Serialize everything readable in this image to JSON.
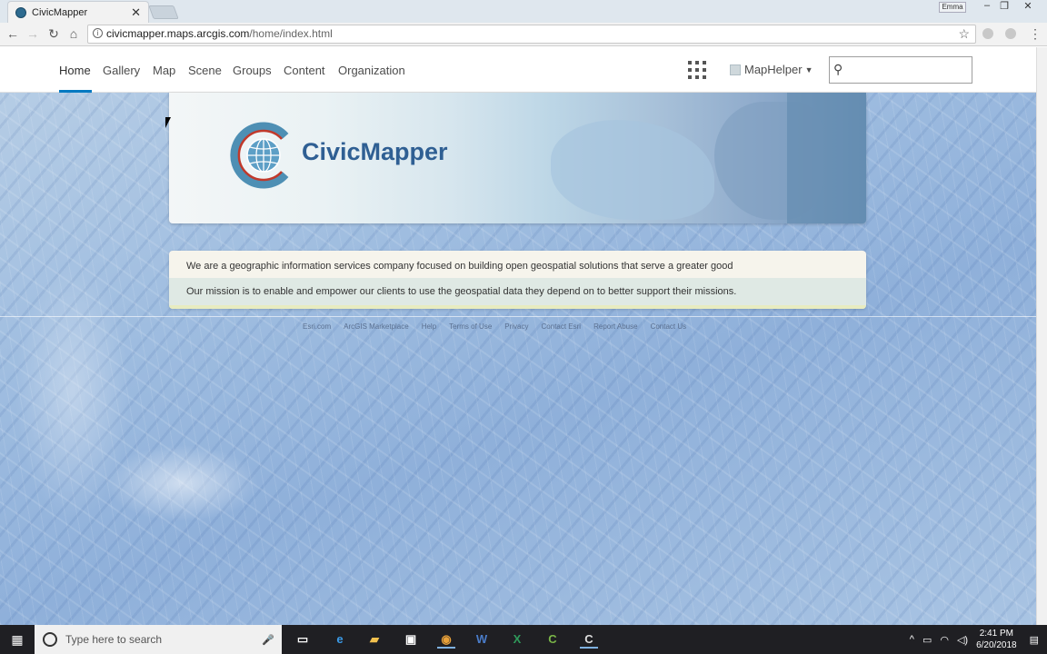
{
  "browser": {
    "tab_title": "CivicMapper",
    "tab_close": "✕",
    "user_chip": "Emma",
    "url_host": "civicmapper.maps.arcgis.com",
    "url_path": "/home/index.html"
  },
  "nav": {
    "links": [
      "Home",
      "Gallery",
      "Map",
      "Scene",
      "Groups",
      "Content",
      "Organization"
    ],
    "user_name": "MapHelper",
    "search_placeholder": ""
  },
  "banner": {
    "brand_name": "CivicMapper"
  },
  "info": {
    "line1": "We are a geographic information services company focused on building open geospatial solutions that serve a greater good",
    "line2": "Our mission is to enable and empower our clients to use the geospatial data they depend on to better support their missions."
  },
  "footer": {
    "links": [
      "Esri.com",
      "ArcGIS Marketplace",
      "Help",
      "Terms of Use",
      "Privacy",
      "Contact Esri",
      "Report Abuse",
      "Contact Us"
    ]
  },
  "taskbar": {
    "search_placeholder": "Type here to search",
    "time": "2:41 PM",
    "date": "6/20/2018"
  },
  "colors": {
    "accent": "#0079c1",
    "brand": "#2f5f93"
  }
}
